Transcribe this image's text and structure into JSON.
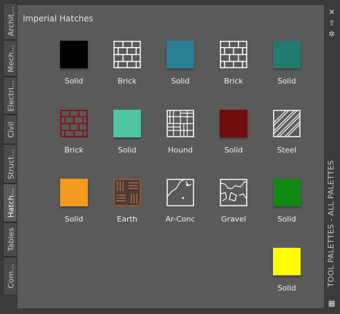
{
  "palette": {
    "section_title": "Imperial Hatches",
    "title": "TOOL PALETTES - ALL PALETTES"
  },
  "tabs": [
    {
      "label": "Archit..."
    },
    {
      "label": "Mech..."
    },
    {
      "label": "Electri..."
    },
    {
      "label": "Civil"
    },
    {
      "label": "Struct..."
    },
    {
      "label": "Hatch..."
    },
    {
      "label": "Tables"
    },
    {
      "label": "Com..."
    }
  ],
  "items": [
    {
      "label": "Solid",
      "color": "#000000",
      "icon": "solid-swatch"
    },
    {
      "label": "Brick",
      "color": "#5a5a5a",
      "icon": "brick-hatch"
    },
    {
      "label": "Solid",
      "color": "#2a7f95",
      "icon": "solid-swatch"
    },
    {
      "label": "Brick",
      "color": "#5a5a5a",
      "icon": "brick-hatch"
    },
    {
      "label": "Solid",
      "color": "#237a6f",
      "icon": "solid-swatch"
    },
    {
      "label": "Brick",
      "color": "#7a1a1f",
      "icon": "brick-hatch"
    },
    {
      "label": "Solid",
      "color": "#4fc4a0",
      "icon": "solid-swatch"
    },
    {
      "label": "Hound",
      "color": "#5a5a5a",
      "icon": "hound-hatch"
    },
    {
      "label": "Solid",
      "color": "#6f0c0c",
      "icon": "solid-swatch"
    },
    {
      "label": "Steel",
      "color": "#5a5a5a",
      "icon": "steel-hatch"
    },
    {
      "label": "Solid",
      "color": "#f39a1e",
      "icon": "solid-swatch"
    },
    {
      "label": "Earth",
      "color": "#5a3a2a",
      "icon": "earth-hatch"
    },
    {
      "label": "Ar-Conc",
      "color": "#5a5a5a",
      "icon": "ar-conc-hatch"
    },
    {
      "label": "Gravel",
      "color": "#5a5a5a",
      "icon": "gravel-hatch"
    },
    {
      "label": "Solid",
      "color": "#108a12",
      "icon": "solid-swatch"
    },
    {
      "label": "Solid",
      "color": "#ffff00",
      "icon": "solid-swatch"
    }
  ]
}
